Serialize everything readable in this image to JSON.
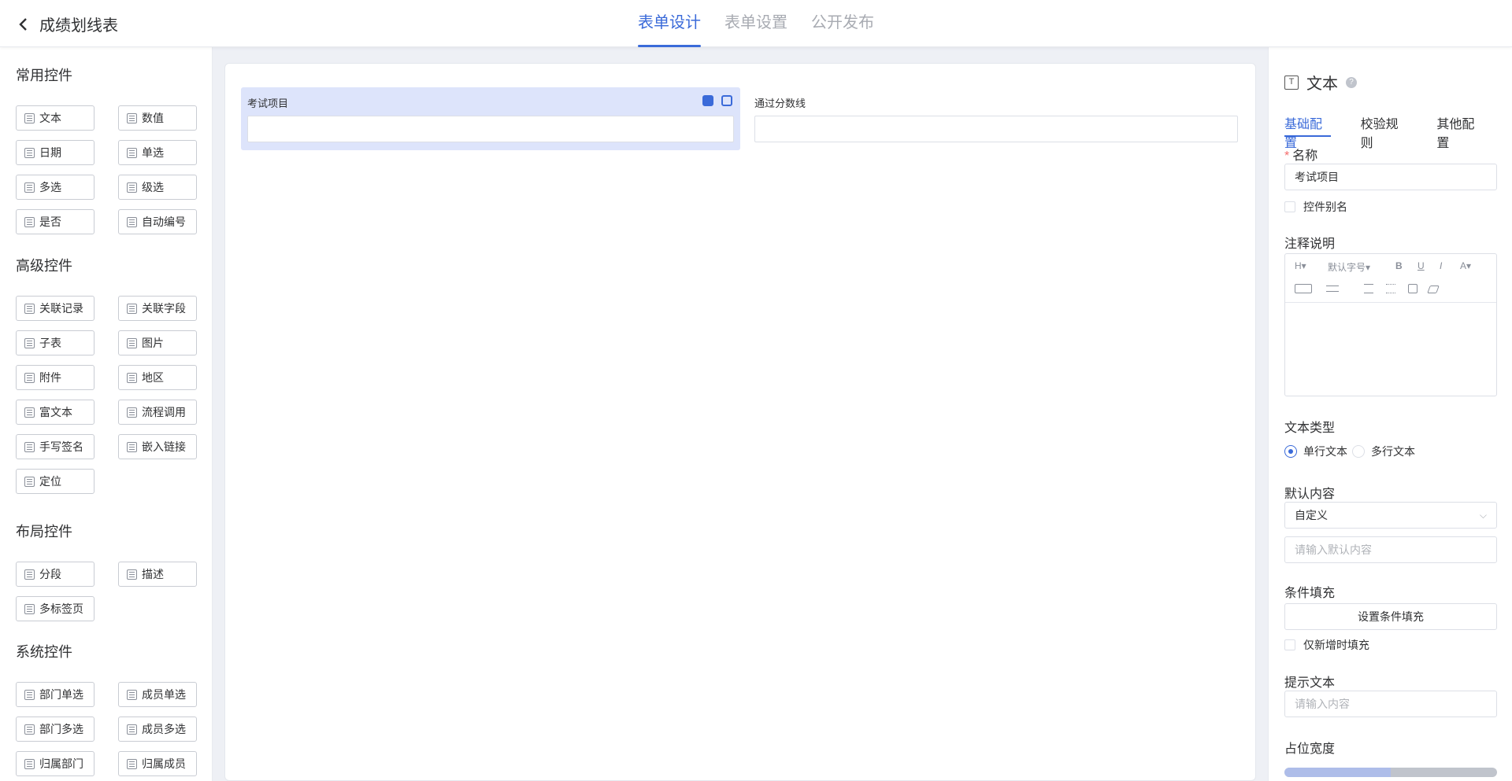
{
  "header": {
    "back_title": "成绩划线表",
    "tabs": [
      "表单设计",
      "表单设置",
      "公开发布"
    ],
    "active_tab": 0
  },
  "left": {
    "groups": [
      {
        "title": "常用控件",
        "items": [
          "文本",
          "数值",
          "日期",
          "单选",
          "多选",
          "级选",
          "是否",
          "自动编号"
        ]
      },
      {
        "title": "高级控件",
        "items": [
          "关联记录",
          "关联字段",
          "子表",
          "图片",
          "附件",
          "地区",
          "富文本",
          "流程调用",
          "手写签名",
          "嵌入链接",
          "定位"
        ]
      },
      {
        "title": "布局控件",
        "items": [
          "分段",
          "描述",
          "多标签页"
        ]
      },
      {
        "title": "系统控件",
        "items": [
          "部门单选",
          "成员单选",
          "部门多选",
          "成员多选",
          "归属部门",
          "归属成员"
        ]
      }
    ]
  },
  "canvas": {
    "fields": [
      {
        "label": "考试项目",
        "selected": true
      },
      {
        "label": "通过分数线",
        "selected": false
      }
    ]
  },
  "right": {
    "title": "文本",
    "help": "?",
    "tabs": [
      "基础配置",
      "校验规则",
      "其他配置"
    ],
    "name_label": "名称",
    "name_required_mark": "*",
    "name_value": "考试项目",
    "alias_label": "控件别名",
    "note_label": "注释说明",
    "toolbar": {
      "heading": "H▾",
      "font_size": "默认字号▾",
      "bold": "B",
      "underline": "U",
      "italic": "I",
      "color": "A▾"
    },
    "text_type_label": "文本类型",
    "text_type_options": [
      "单行文本",
      "多行文本"
    ],
    "text_type_selected": 0,
    "default_label": "默认内容",
    "default_select": "自定义",
    "default_placeholder": "请输入默认内容",
    "cond_label": "条件填充",
    "cond_button": "设置条件填充",
    "cond_only_new": "仅新增时填充",
    "hint_label": "提示文本",
    "hint_placeholder": "请输入内容",
    "width_label": "占位宽度",
    "width_fraction": 0.5,
    "accent": "#3a6ad9"
  }
}
